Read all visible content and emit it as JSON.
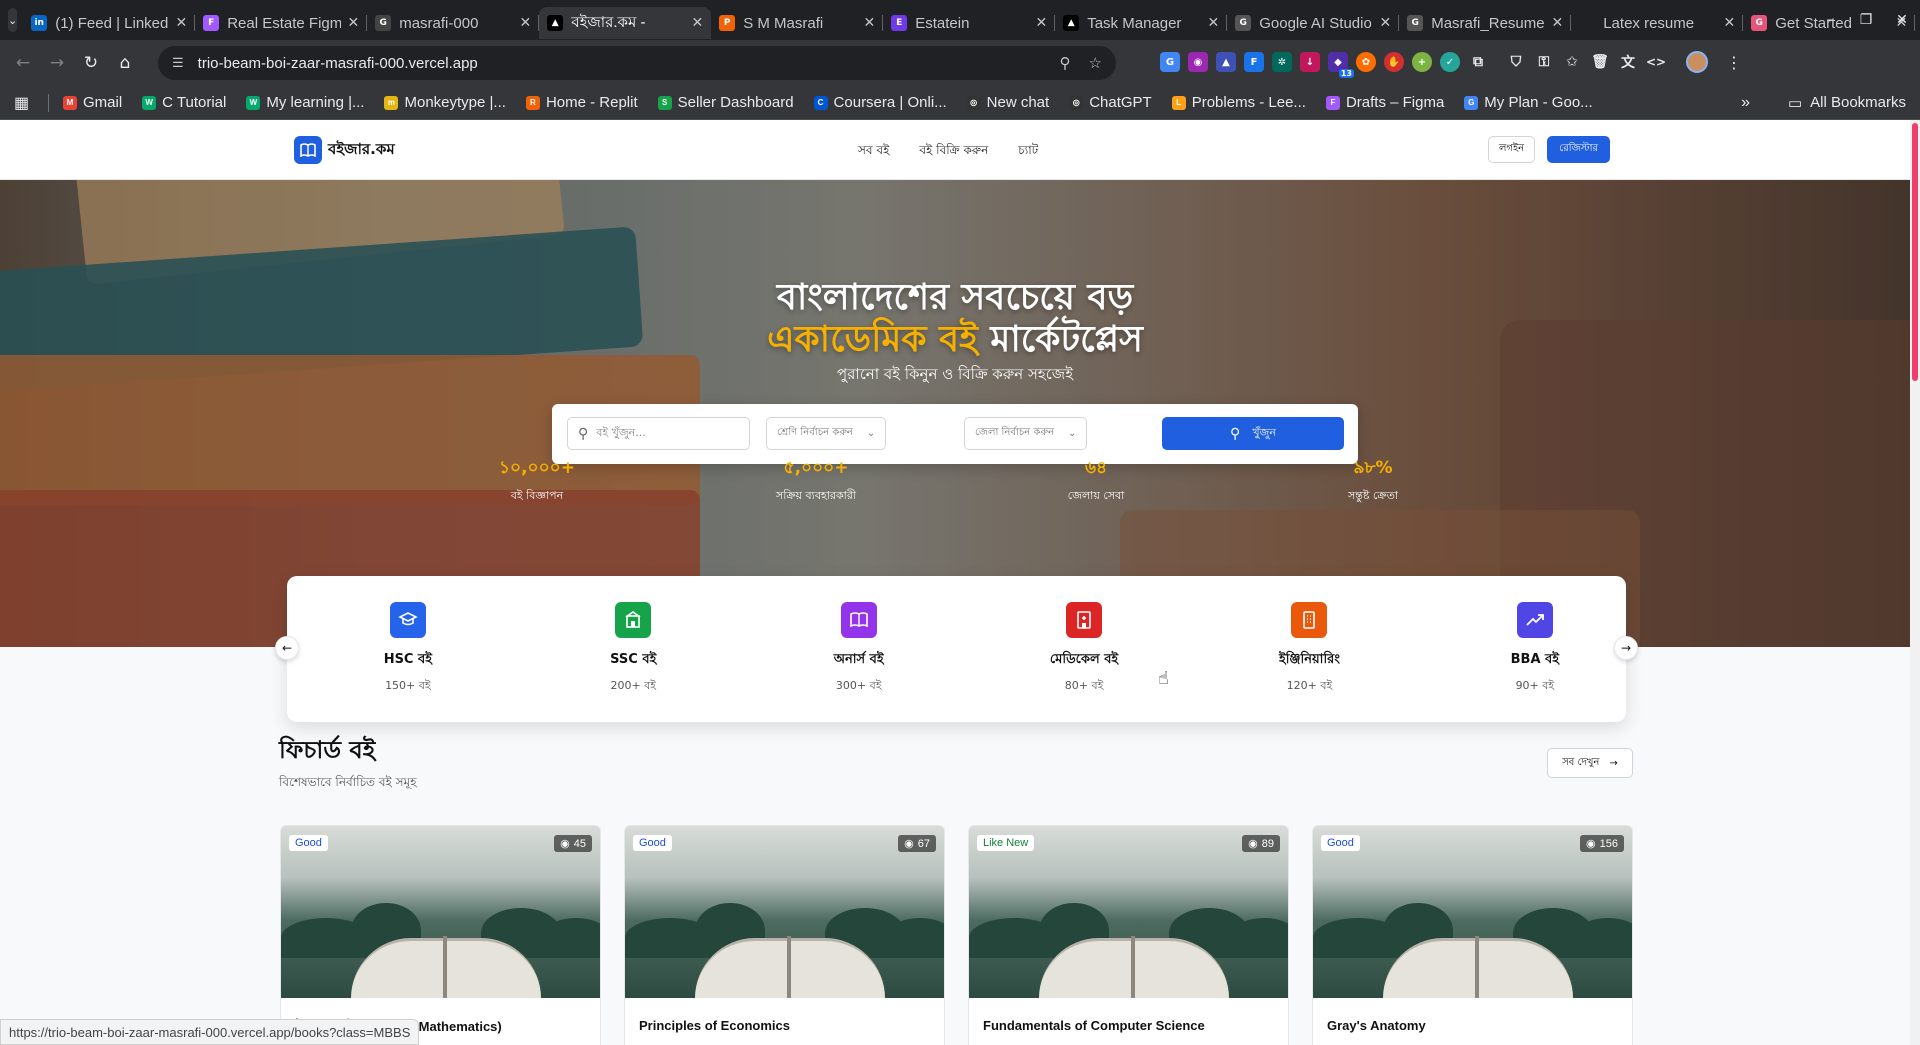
{
  "browser": {
    "tabs": [
      {
        "title": "(1) Feed | LinkedIn",
        "fav": "in",
        "color": "#0a66c2"
      },
      {
        "title": "Real Estate Figma",
        "fav": "F",
        "color": "#a259ff"
      },
      {
        "title": "masrafi-000",
        "fav": "G",
        "color": "#444"
      },
      {
        "title": "বইজার.কম -",
        "fav": "▲",
        "color": "#000"
      },
      {
        "title": "S M Masrafi",
        "fav": "P",
        "color": "#f26207"
      },
      {
        "title": "Estatein",
        "fav": "E",
        "color": "#703be7"
      },
      {
        "title": "Task Manager",
        "fav": "▲",
        "color": "#000"
      },
      {
        "title": "Google AI Studio",
        "fav": "G",
        "color": "#555"
      },
      {
        "title": "Masrafi_Resume",
        "fav": "G",
        "color": "#555"
      },
      {
        "title": "Latex resume",
        "fav": "",
        "color": "#202124"
      },
      {
        "title": "Get Started",
        "fav": "G",
        "color": "#e5547a"
      }
    ],
    "url": "trio-beam-boi-zaar-masrafi-000.vercel.app",
    "bookmarks": [
      {
        "label": "Gmail",
        "fav": "M",
        "color": "#ea4335"
      },
      {
        "label": "C Tutorial",
        "fav": "W",
        "color": "#04aa6d"
      },
      {
        "label": "My learning |...",
        "fav": "W",
        "color": "#04aa6d"
      },
      {
        "label": "Monkeytype |...",
        "fav": "m",
        "color": "#e2b714"
      },
      {
        "label": "Home - Replit",
        "fav": "R",
        "color": "#f26207"
      },
      {
        "label": "Seller Dashboard",
        "fav": "S",
        "color": "#16a34a"
      },
      {
        "label": "Coursera | Onli...",
        "fav": "C",
        "color": "#0056d2"
      },
      {
        "label": "New chat",
        "fav": "◎",
        "color": "#333"
      },
      {
        "label": "ChatGPT",
        "fav": "◎",
        "color": "#333"
      },
      {
        "label": "Problems - Lee...",
        "fav": "L",
        "color": "#ffa116"
      },
      {
        "label": "Drafts – Figma",
        "fav": "F",
        "color": "#a259ff"
      },
      {
        "label": "My Plan - Goo...",
        "fav": "G",
        "color": "#4285f4"
      }
    ],
    "all_bookmarks": "All Bookmarks",
    "ext_badge": "13",
    "status_url": "https://trio-beam-boi-zaar-masrafi-000.vercel.app/books?class=MBBS"
  },
  "header": {
    "logo": "বইজার.কম",
    "nav": [
      "সব বই",
      "বই বিক্রি করুন",
      "চ্যাট"
    ],
    "login": "লগইন",
    "register": "রেজিস্টার"
  },
  "hero": {
    "line1": "বাংলাদেশের সবচেয়ে বড়",
    "line2_accent": "একাডেমিক বই",
    "line2_rest": " মার্কেটপ্লেস",
    "subtitle": "পুরানো বই কিনুন ও বিক্রি করুন সহজেই",
    "search_placeholder": "বই খুঁজুন...",
    "class_select": "শ্রেণি নির্বাচন করুন",
    "district_select": "জেলা নির্বাচন করুন",
    "search_button": "খুঁজুন",
    "stats": [
      {
        "value": "১০,০০০+",
        "label": "বই বিজ্ঞাপন"
      },
      {
        "value": "৫,০০০+",
        "label": "সক্রিয় ব্যবহারকারী"
      },
      {
        "value": "৬৪",
        "label": "জেলায় সেবা"
      },
      {
        "value": "৯৮%",
        "label": "সন্তুষ্ট ক্রেতা"
      }
    ]
  },
  "categories": [
    {
      "name": "HSC বই",
      "count": "150+ বই",
      "color": "#2563eb",
      "icon": "graduation-cap-icon"
    },
    {
      "name": "SSC বই",
      "count": "200+ বই",
      "color": "#16a34a",
      "icon": "school-icon"
    },
    {
      "name": "অনার্স বই",
      "count": "300+ বই",
      "color": "#9333ea",
      "icon": "book-open-icon"
    },
    {
      "name": "মেডিকেল বই",
      "count": "80+ বই",
      "color": "#dc2626",
      "icon": "hospital-icon"
    },
    {
      "name": "ইঞ্জিনিয়ারিং",
      "count": "120+ বই",
      "color": "#ea580c",
      "icon": "building-icon"
    },
    {
      "name": "BBA বই",
      "count": "90+ বই",
      "color": "#4f46e5",
      "icon": "trending-up-icon"
    }
  ],
  "featured": {
    "title": "ফিচার্ড বই",
    "subtitle": "বিশেষভাবে নির্বাচিত বই সমূহ",
    "view_all": "সব দেখুন",
    "books": [
      {
        "condition": "Good",
        "views": "45",
        "title": "উচ্চতর গণিত (Higher Mathematics)"
      },
      {
        "condition": "Good",
        "views": "67",
        "title": "Principles of Economics"
      },
      {
        "condition": "Like New",
        "views": "89",
        "title": "Fundamentals of Computer Science"
      },
      {
        "condition": "Good",
        "views": "156",
        "title": "Gray's Anatomy"
      }
    ]
  }
}
